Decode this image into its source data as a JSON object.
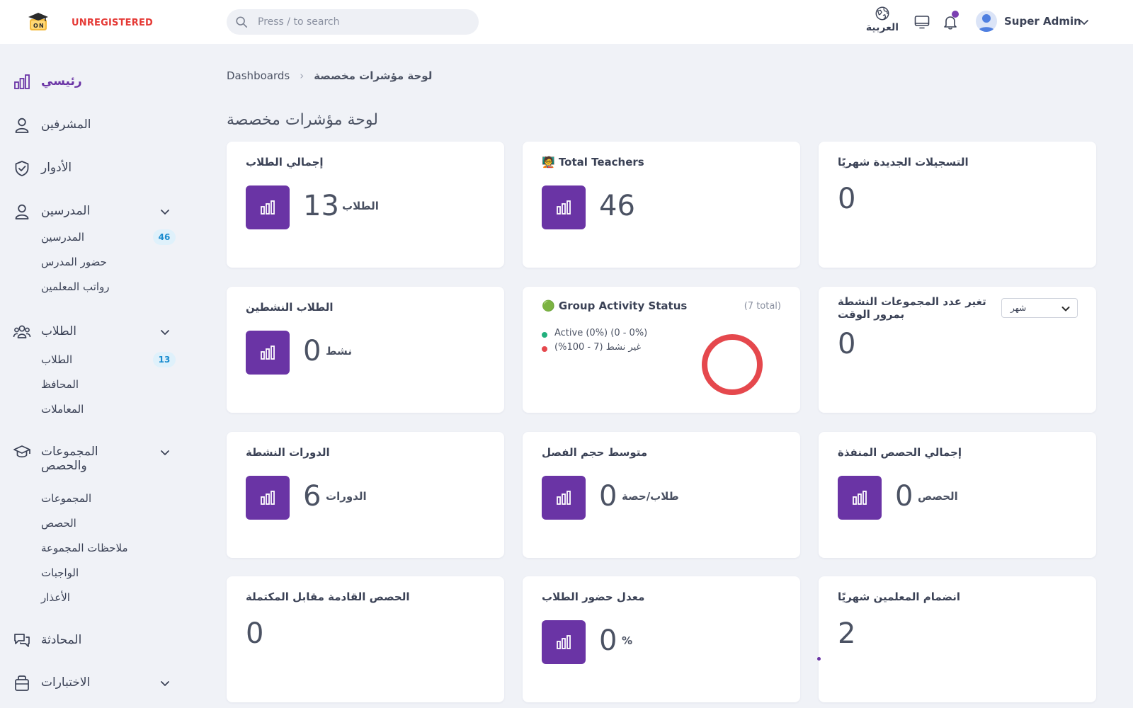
{
  "header": {
    "brand_tag": "UNREGISTERED",
    "search_placeholder": "Press / to search",
    "language_label": "العربية",
    "user_name": "Super Admin",
    "notification_dot_color": "#7b3fb1"
  },
  "sidebar": {
    "main": "رئيسي",
    "supervisors": "المشرفين",
    "roles": "الأدوار",
    "teachers_group": {
      "label": "المدرسين",
      "items": [
        {
          "label": "المدرسين",
          "badge": "46"
        },
        {
          "label": "حضور المدرس"
        },
        {
          "label": "رواتب المعلمين"
        }
      ]
    },
    "students_group": {
      "label": "الطلاب",
      "items": [
        {
          "label": "الطلاب",
          "badge": "13"
        },
        {
          "label": "المحافظ"
        },
        {
          "label": "المعاملات"
        }
      ]
    },
    "groups_group": {
      "label_line1": "المجموعات",
      "label_line2": "والحصص",
      "items": [
        {
          "label": "المجموعات"
        },
        {
          "label": "الحصص"
        },
        {
          "label": "ملاحظات المجموعة"
        },
        {
          "label": "الواجبات"
        },
        {
          "label": "الأعذار"
        }
      ]
    },
    "chat": "المحادثة",
    "exams": "الاختبارات"
  },
  "breadcrumb": {
    "root": "Dashboards",
    "current": "لوحة مؤشرات مخصصة"
  },
  "page_title": "لوحة مؤشرات مخصصة",
  "cards": {
    "total_students": {
      "title": "إجمالي الطلاب",
      "value": "13",
      "unit": "الطلاب"
    },
    "total_teachers": {
      "title": "🧑‍🏫 Total Teachers",
      "value": "46"
    },
    "monthly_registrations": {
      "title": "التسجيلات الجديدة شهريًا",
      "value": "0"
    },
    "active_students": {
      "title": "الطلاب النشطين",
      "value": "0",
      "unit": "نشط"
    },
    "group_activity": {
      "title": "🟢 Group Activity Status",
      "total": "(7 total)",
      "legend": [
        {
          "label": "Active (0%) (0 - 0%)",
          "color": "#22b07d"
        },
        {
          "label": "غير نشط (7 - 100%)",
          "color": "#e5484d"
        }
      ]
    },
    "active_groups_change": {
      "title_line1": "تغير عدد المجموعات النشطة",
      "title_line2": "بمرور الوقت",
      "value": "0",
      "dropdown": "شهر"
    },
    "active_courses": {
      "title": "الدورات النشطة",
      "value": "6",
      "unit": "الدورات"
    },
    "avg_class_size": {
      "title": "متوسط حجم الفصل",
      "value": "0",
      "unit": "طلاب/حصة"
    },
    "total_sessions": {
      "title": "إجمالي الحصص المنفذة",
      "value": "0",
      "unit": "الحصص"
    },
    "upcoming_vs_completed": {
      "title": "الحصص القادمة مقابل المكتملة",
      "value": "0"
    },
    "attendance_rate": {
      "title": "معدل حضور الطلاب",
      "value": "0",
      "unit": "%"
    },
    "monthly_teacher_joins": {
      "title": "انضمام المعلمين شهريًا",
      "value": "2"
    }
  },
  "colors": {
    "accent": "#6a34a5",
    "active": "#22b07d",
    "inactive": "#e5484d",
    "badge_bg": "#dff1fb",
    "badge_text": "#1a8ccf",
    "brand_tag": "#e53935"
  },
  "chart_data": {
    "type": "pie",
    "categories": [
      "Active",
      "غير نشط"
    ],
    "values": [
      0,
      7
    ]
  }
}
